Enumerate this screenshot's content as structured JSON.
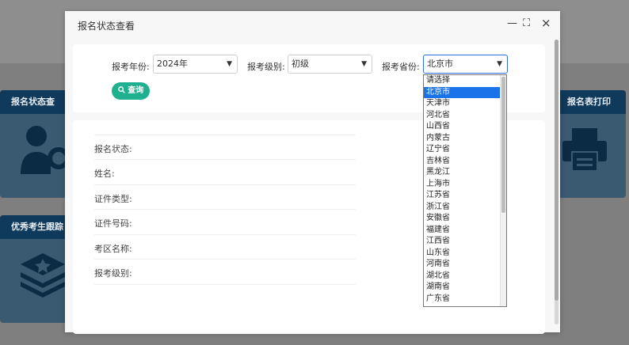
{
  "background": {
    "card_status": "报名状态查",
    "card_print": "报名表打印",
    "card_excellent": "优秀考生跟踪"
  },
  "modal": {
    "title": "报名状态查看",
    "minimize": "—",
    "maximize": "⛶",
    "close": "×"
  },
  "filters": {
    "year_label": "报考年份:",
    "year_value": "2024年",
    "level_label": "报考级别:",
    "level_value": "初级",
    "province_label": "报考省份:",
    "province_value": "北京市",
    "query_button": "查询"
  },
  "info": {
    "status": "报名状态:",
    "name": "姓名:",
    "id_type": "证件类型:",
    "id_number": "证件号码:",
    "region": "考区名称:",
    "level": "报考级别:"
  },
  "province_options": [
    "请选择",
    "北京市",
    "天津市",
    "河北省",
    "山西省",
    "内蒙古",
    "辽宁省",
    "吉林省",
    "黑龙江",
    "上海市",
    "江苏省",
    "浙江省",
    "安徽省",
    "福建省",
    "江西省",
    "山东省",
    "河南省",
    "湖北省",
    "湖南省",
    "广东省"
  ],
  "province_selected_index": 1
}
